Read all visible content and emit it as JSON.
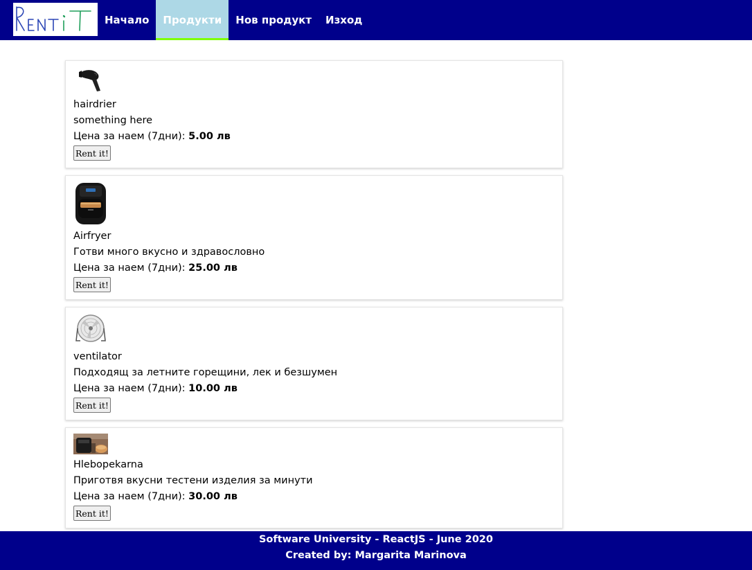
{
  "header": {
    "logo_text": "RentiT",
    "nav": [
      {
        "label": "Начало",
        "active": false
      },
      {
        "label": "Продукти",
        "active": true
      },
      {
        "label": "Нов продукт",
        "active": false
      },
      {
        "label": "Изход",
        "active": false
      }
    ],
    "colors": {
      "background": "#00008b",
      "active_tab": "#add8e6",
      "active_underline": "#7fff00"
    }
  },
  "products": [
    {
      "name": "hairdrier",
      "description": "something here",
      "price_label": "Цена за наем (7дни):",
      "price": "5.00 лв",
      "button": "Rent it!",
      "image": "hairdryer-image"
    },
    {
      "name": "Airfryer",
      "description": "Готви много вкусно и здравословно",
      "price_label": "Цена за наем (7дни):",
      "price": "25.00 лв",
      "button": "Rent it!",
      "image": "airfryer-image"
    },
    {
      "name": "ventilator",
      "description": "Подходящ за летните горещини, лек и безшумен",
      "price_label": "Цена за наем (7дни):",
      "price": "10.00 лв",
      "button": "Rent it!",
      "image": "fan-image"
    },
    {
      "name": "Hlebopekarna",
      "description": "Приготвя вкусни тестени изделия за минути",
      "price_label": "Цена за наем (7дни):",
      "price": "30.00 лв",
      "button": "Rent it!",
      "image": "breadmaker-image"
    }
  ],
  "footer": {
    "line1": "Software University - ReactJS - June 2020",
    "line2": "Created by: Margarita Marinova"
  }
}
